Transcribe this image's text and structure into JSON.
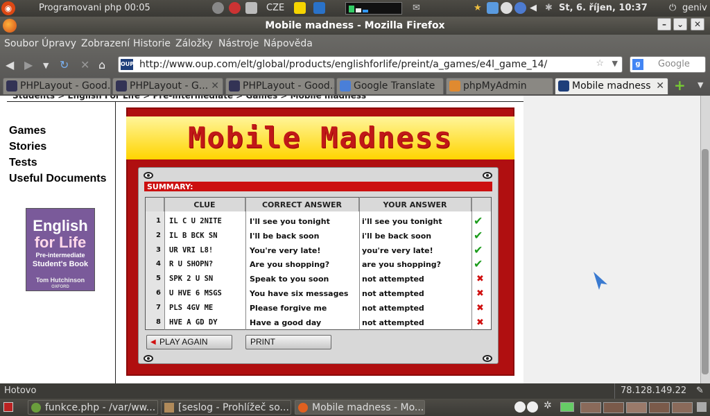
{
  "top_panel": {
    "active_app": "Programovani php 00:05",
    "keyboard": "CZE",
    "clock": "St,  6. říjen, 10:37",
    "user": "geniv"
  },
  "window": {
    "title": "Mobile madness - Mozilla Firefox"
  },
  "menu": [
    "Soubor",
    "Úpravy",
    "Zobrazení",
    "Historie",
    "Záložky",
    "Nástroje",
    "Nápověda"
  ],
  "url": "http://www.oup.com/elt/global/products/englishforlife/preint/a_games/e4l_game_14/",
  "search_placeholder": "Google",
  "tabs": [
    {
      "label": "PHPLayout - Good...",
      "active": false
    },
    {
      "label": "PHPLayout - G...",
      "active": false
    },
    {
      "label": "PHPLayout - Good...",
      "active": false
    },
    {
      "label": "Google Translate",
      "active": false
    },
    {
      "label": "phpMyAdmin",
      "active": false
    },
    {
      "label": "Mobile madness",
      "active": true
    }
  ],
  "page": {
    "breadcrumb": "Students > English For Life > Pre-intermediate > Games > Mobile madness",
    "nav": [
      "Games",
      "Stories",
      "Tests",
      "Useful Documents"
    ],
    "book": {
      "line1": "English",
      "line2": "for Life",
      "line3": "Pre-intermediate",
      "line4": "Student's Book",
      "author": "Tom Hutchinson",
      "publisher": "OXFORD"
    }
  },
  "game": {
    "title": "Mobile Madness",
    "summary_label": "SUMMARY:",
    "columns": [
      "CLUE",
      "CORRECT ANSWER",
      "YOUR ANSWER"
    ],
    "rows": [
      {
        "n": "1",
        "clue": "IL C U 2NITE",
        "correct": "I'll see you tonight",
        "yours": "i'll see you tonight",
        "ok": true
      },
      {
        "n": "2",
        "clue": "IL B BCK SN",
        "correct": "I'll be back soon",
        "yours": "i'll be back soon",
        "ok": true
      },
      {
        "n": "3",
        "clue": "UR VRI L8!",
        "correct": "You're very late!",
        "yours": "you're very late!",
        "ok": true
      },
      {
        "n": "4",
        "clue": "R U SHOPN?",
        "correct": "Are you shopping?",
        "yours": "are you shopping?",
        "ok": true
      },
      {
        "n": "5",
        "clue": "SPK 2 U SN",
        "correct": "Speak to you soon",
        "yours": "not attempted",
        "ok": false
      },
      {
        "n": "6",
        "clue": "U HVE 6 MSGS",
        "correct": "You have six messages",
        "yours": "not attempted",
        "ok": false
      },
      {
        "n": "7",
        "clue": "PLS 4GV ME",
        "correct": "Please forgive me",
        "yours": "not attempted",
        "ok": false
      },
      {
        "n": "8",
        "clue": "HVE A GD DY",
        "correct": "Have a good day",
        "yours": "not attempted",
        "ok": false
      }
    ],
    "play_again": "PLAY AGAIN",
    "print": "PRINT"
  },
  "status": {
    "text": "Hotovo",
    "ip": "78.128.149.22"
  },
  "taskbar": [
    {
      "label": "funkce.php - /var/ww...",
      "active": false
    },
    {
      "label": "[seslog - Prohlížeč so...",
      "active": false
    },
    {
      "label": "Mobile madness - Mo...",
      "active": true
    }
  ],
  "icons": [
    "ubuntu-logo-icon",
    "firefox-icon",
    "oup-favicon-icon",
    "checkmark-icon",
    "cross-icon"
  ]
}
